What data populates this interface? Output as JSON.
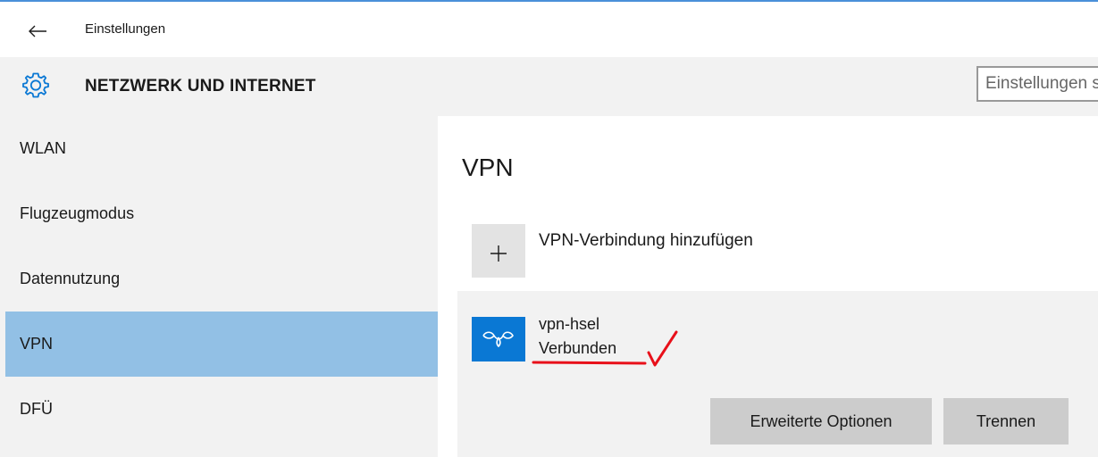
{
  "titlebar": {
    "back_icon": "back-arrow-icon",
    "title": "Einstellungen"
  },
  "header": {
    "icon": "gear-icon",
    "title": "NETZWERK UND INTERNET",
    "search_value": "Einstellungen suchen"
  },
  "sidebar": {
    "items": [
      {
        "label": "WLAN",
        "active": false
      },
      {
        "label": "Flugzeugmodus",
        "active": false
      },
      {
        "label": "Datennutzung",
        "active": false
      },
      {
        "label": "VPN",
        "active": true
      },
      {
        "label": "DFÜ",
        "active": false
      }
    ]
  },
  "main": {
    "heading": "VPN",
    "add_connection": {
      "icon": "plus-icon",
      "label": "VPN-Verbindung hinzufügen"
    },
    "connection": {
      "icon": "vpn-icon",
      "name": "vpn-hsel",
      "status": "Verbunden",
      "advanced_button": "Erweiterte Optionen",
      "disconnect_button": "Trennen"
    }
  },
  "colors": {
    "accent": "#0a78d4",
    "nav_active": "#92c0e5",
    "panel_bg": "#f2f2f2",
    "button_bg": "#cccccc",
    "annotation_red": "#e8101a"
  }
}
